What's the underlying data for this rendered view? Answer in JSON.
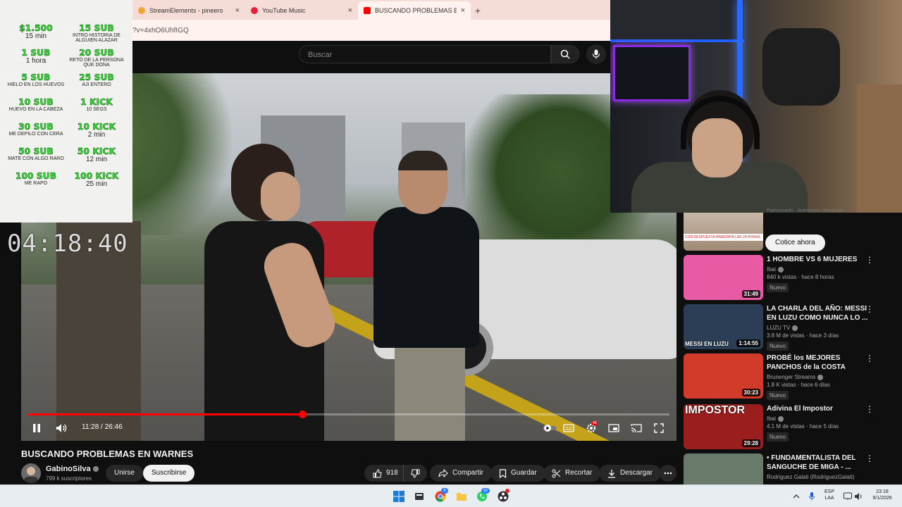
{
  "browser": {
    "tabs": [
      {
        "title": "StreamElements - pineero",
        "favicon_color": "#f2a533",
        "active": false
      },
      {
        "title": "YouTube Music",
        "favicon_color": "#e6213a",
        "active": false
      },
      {
        "title": "BUSCANDO PROBLEMAS EN W...",
        "favicon_color": "#ff0000",
        "active": true
      }
    ],
    "new_tab": "+",
    "close": "×",
    "url": "?v=4xhO6UhfIGQ"
  },
  "youtube": {
    "search_placeholder": "Buscar"
  },
  "overlay": {
    "goals": [
      [
        {
          "title": "$1.500",
          "desc": "15 min",
          "big": true
        },
        {
          "title": "15 SUB",
          "desc": "Intro historia de alguien alazar",
          "big": false
        }
      ],
      [
        {
          "title": "1 SUB",
          "desc": "1 hora",
          "big": true
        },
        {
          "title": "20 SUB",
          "desc": "Reto de la persona que dona",
          "big": false
        }
      ],
      [
        {
          "title": "5 SUB",
          "desc": "Hielo en los huevos",
          "big": false
        },
        {
          "title": "25 SUB",
          "desc": "Aji entero",
          "big": false
        }
      ],
      [
        {
          "title": "10 SUB",
          "desc": "Huevo en la cabeza",
          "big": false
        },
        {
          "title": "1 KICK",
          "desc": "10 SEGS",
          "big": false
        }
      ],
      [
        {
          "title": "30 SUB",
          "desc": "Me depilo con cera",
          "big": false
        },
        {
          "title": "10 KICK",
          "desc": "2 min",
          "big": true
        }
      ],
      [
        {
          "title": "50 SUB",
          "desc": "Mate con algo raro",
          "big": false
        },
        {
          "title": "50 KICK",
          "desc": "12 min",
          "big": true
        }
      ],
      [
        {
          "title": "100 SUB",
          "desc": "Me rapo",
          "big": false
        },
        {
          "title": "100 KICK",
          "desc": "25 min",
          "big": true
        }
      ]
    ],
    "timer": "04:18:40"
  },
  "player": {
    "time": "11:28 / 26:46",
    "progress": 0.428,
    "icons": [
      "pause-icon",
      "volume-icon",
      "autoplay-icon",
      "subtitles-icon",
      "settings-icon",
      "miniplayer-icon",
      "cast-icon",
      "fullscreen-icon"
    ],
    "settings_badge": "4K"
  },
  "video": {
    "title": "BUSCANDO PROBLEMAS EN WARNES",
    "channel": "GabinoSilva",
    "subscribers": "799 k suscriptores",
    "join": "Unirse",
    "subscribe": "Suscribirse",
    "likes": "918",
    "share": "Compartir",
    "save": "Guardar",
    "clip": "Recortar",
    "download": "Descargar"
  },
  "sidebar": {
    "ad": {
      "header": "Patrocinado · Autorelatio Vendedor",
      "thumb_text": "CON RESPUESTA INMEDIATA LAS 24 HORAS",
      "cta": "Cotice ahora"
    },
    "items": [
      {
        "title": "1 HOMBRE VS 6 MUJERES",
        "channel": "Ibai",
        "meta": "840 k vistas · hace 8 horas",
        "duration": "31:49",
        "badge": "Nuevo",
        "thumb": "#e85aa3",
        "thumb_text": ""
      },
      {
        "title": "LA CHARLA DEL AÑO: MESSI EN LUZU COMO NUNCA LO ...",
        "channel": "LUZU TV",
        "meta": "3.8 M de vistas · hace 3 días",
        "duration": "1:14:55",
        "badge": "Nuevo",
        "thumb": "#2c3e56",
        "thumb_text": "MESSI EN LUZU"
      },
      {
        "title": "PROBÉ los MEJORES PANCHOS de la COSTA ARGENTINA",
        "channel": "Brunenger Streams",
        "meta": "1.8 K vistas · hace 6 días",
        "duration": "30:23",
        "badge": "Nuevo",
        "thumb": "#d23a2a",
        "thumb_text": ""
      },
      {
        "title": "Adivina El Impostor",
        "channel": "Ibai",
        "meta": "4.1 M de vistas · hace 5 días",
        "duration": "29:28",
        "badge": "Nuevo",
        "thumb": "#9a1e1e",
        "thumb_text": "IMPOSTOR"
      },
      {
        "title": "• FUNDAMENTALISTA DEL SANGUCHE DE MIGA - ...",
        "channel": "Rodriguez Galati (RodriguezGalati)",
        "meta": "",
        "duration": "",
        "badge": "",
        "thumb": "#6a7a6a",
        "thumb_text": ""
      }
    ]
  },
  "taskbar": {
    "lang_top": "ESP",
    "lang_bottom": "LAA",
    "time": "23:18",
    "date": "9/1/2026",
    "whatsapp_badge": "53",
    "chrome_badge": "8"
  }
}
